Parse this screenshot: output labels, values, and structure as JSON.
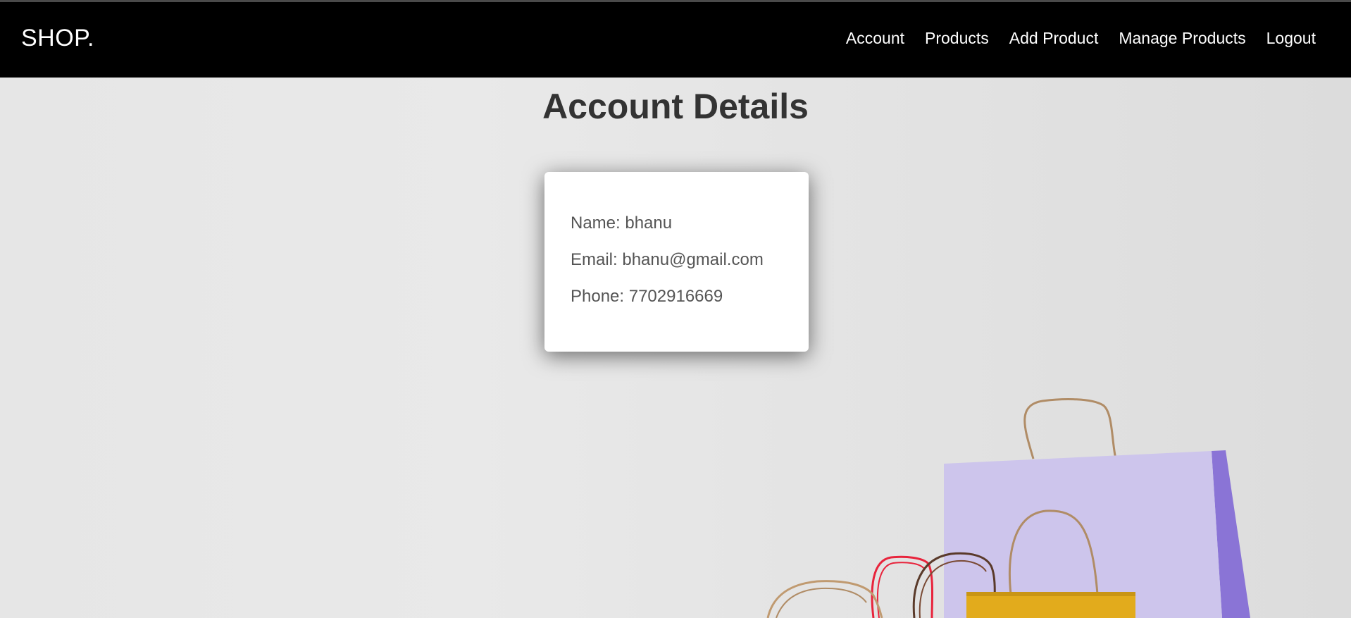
{
  "brand": "SHOP.",
  "nav": {
    "account": "Account",
    "products": "Products",
    "add_product": "Add Product",
    "manage_products": "Manage Products",
    "logout": "Logout"
  },
  "page_title": "Account Details",
  "account": {
    "name": "Name: bhanu",
    "email": "Email: bhanu@gmail.com",
    "phone": "Phone: 7702916669"
  },
  "colors": {
    "navbar_bg": "#000000",
    "background": "#e5e5e5",
    "card_bg": "#ffffff",
    "title_text": "#333333",
    "card_text": "#555555",
    "bag_lilac": "#cbc3ea",
    "bag_purple": "#8c77d8",
    "bag_yellow": "#e2ab1c",
    "handle_red": "#e8243c",
    "handle_tan": "#b58a5e",
    "handle_brown": "#5a3a2a"
  }
}
